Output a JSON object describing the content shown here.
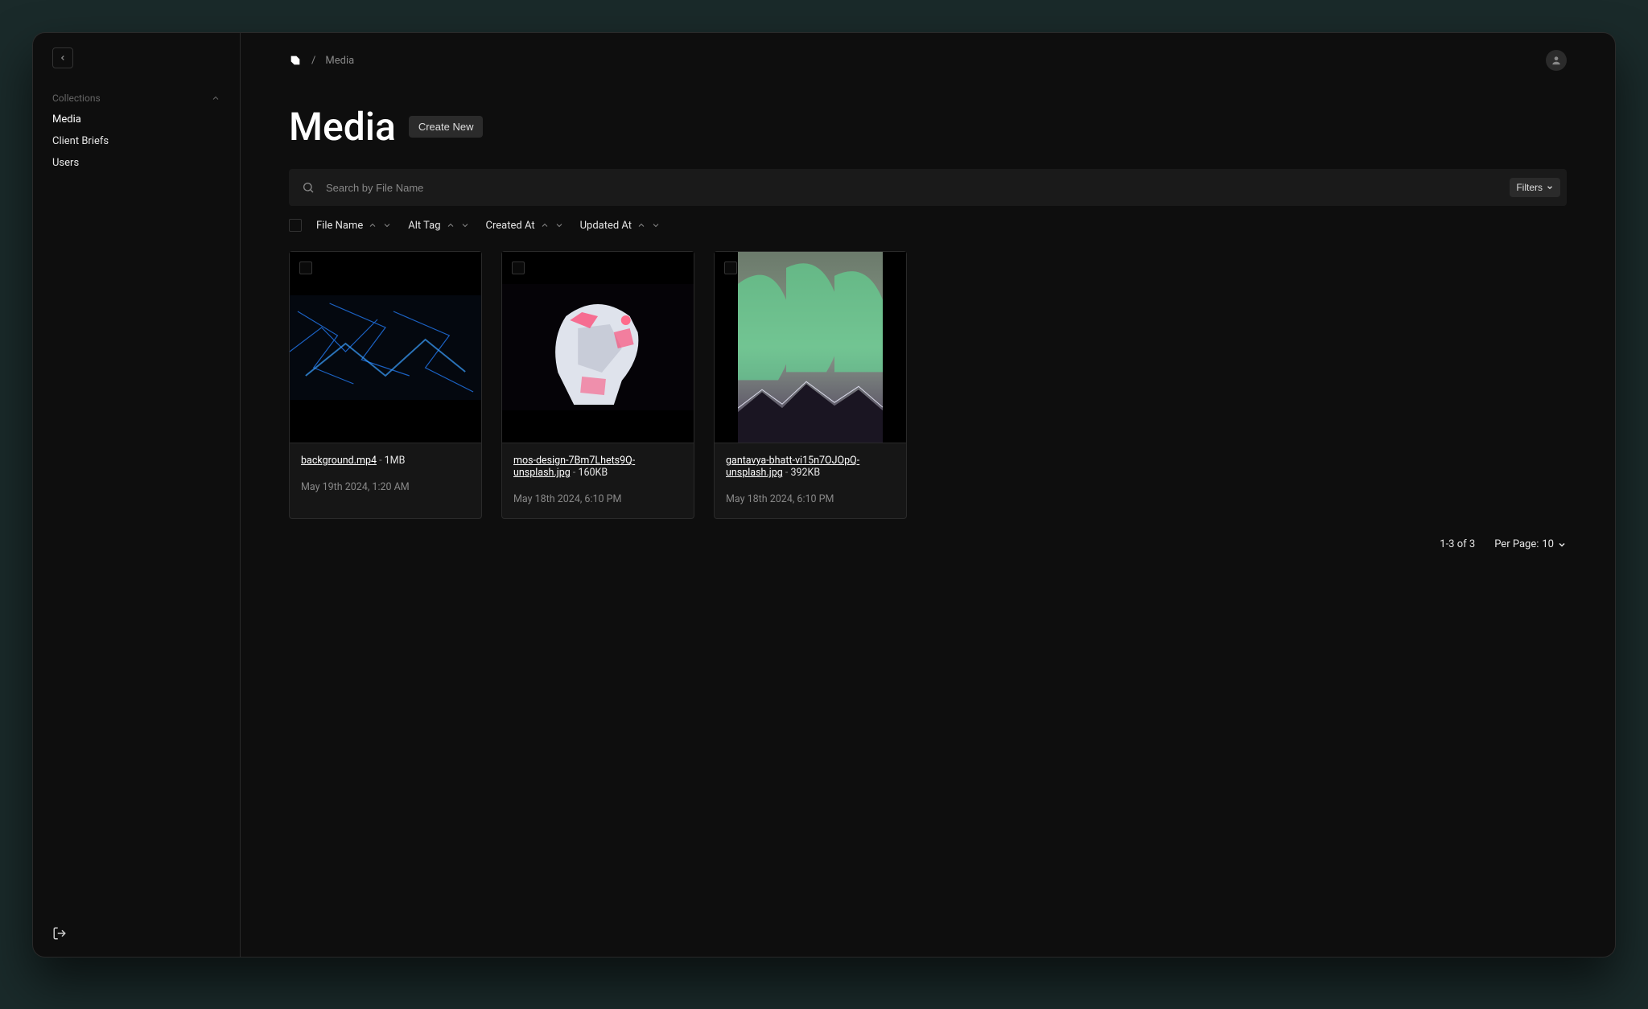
{
  "sidebar": {
    "group_label": "Collections",
    "items": [
      {
        "label": "Media"
      },
      {
        "label": "Client Briefs"
      },
      {
        "label": "Users"
      }
    ]
  },
  "breadcrumb": {
    "current": "Media",
    "separator": "/"
  },
  "header": {
    "title": "Media",
    "create_label": "Create New"
  },
  "search": {
    "placeholder": "Search by File Name",
    "filters_label": "Filters"
  },
  "columns": {
    "file_name": "File Name",
    "alt_tag": "Alt Tag",
    "created_at": "Created At",
    "updated_at": "Updated At"
  },
  "cards": [
    {
      "filename": "background.mp4",
      "filesize": "1MB",
      "date": "May 19th 2024, 1:20 AM"
    },
    {
      "filename": "mos-design-7Bm7Lhets9Q-unsplash.jpg",
      "filesize": "160KB",
      "date": "May 18th 2024, 6:10 PM"
    },
    {
      "filename": "gantavya-bhatt-vi15n7OJOpQ-unsplash.jpg",
      "filesize": "392KB",
      "date": "May 18th 2024, 6:10 PM"
    }
  ],
  "pagination": {
    "range": "1-3 of 3",
    "per_page_label": "Per Page:",
    "per_page_value": "10"
  },
  "misc": {
    "dash": " - "
  }
}
